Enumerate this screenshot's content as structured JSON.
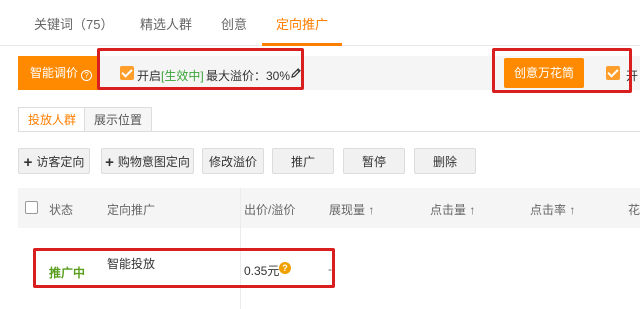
{
  "tabs": [
    {
      "label": "关键词（75）",
      "active": false
    },
    {
      "label": "精选人群",
      "active": false
    },
    {
      "label": "创意",
      "active": false
    },
    {
      "label": "定向推广",
      "active": true
    }
  ],
  "smart_bar": {
    "label": "智能调价",
    "help_glyph": "?",
    "enable_label": "开启",
    "status": "[生效中]",
    "max_premium": "最大溢价：30%",
    "enabled": true
  },
  "creative_button": "创意万花筒",
  "creative_toggle_label": "开",
  "sub_tabs": [
    {
      "label": "投放人群",
      "active": true
    },
    {
      "label": "展示位置",
      "active": false
    }
  ],
  "actions": [
    "访客定向",
    "购物意图定向",
    "修改溢价",
    "推广",
    "暂停",
    "删除"
  ],
  "table": {
    "headers": [
      "状态",
      "定向推广",
      "出价/溢价",
      "展现量 ↑",
      "点击量 ↑",
      "点击率 ↑",
      "花"
    ],
    "rows": [
      {
        "status": "推广中",
        "name": "智能投放",
        "price": "0.35元",
        "help_glyph": "?",
        "impressions": "-"
      }
    ]
  },
  "colors": {
    "accent": "#ff8a00",
    "highlight": "#d81e1e",
    "active_status": "#5a9e1f"
  }
}
